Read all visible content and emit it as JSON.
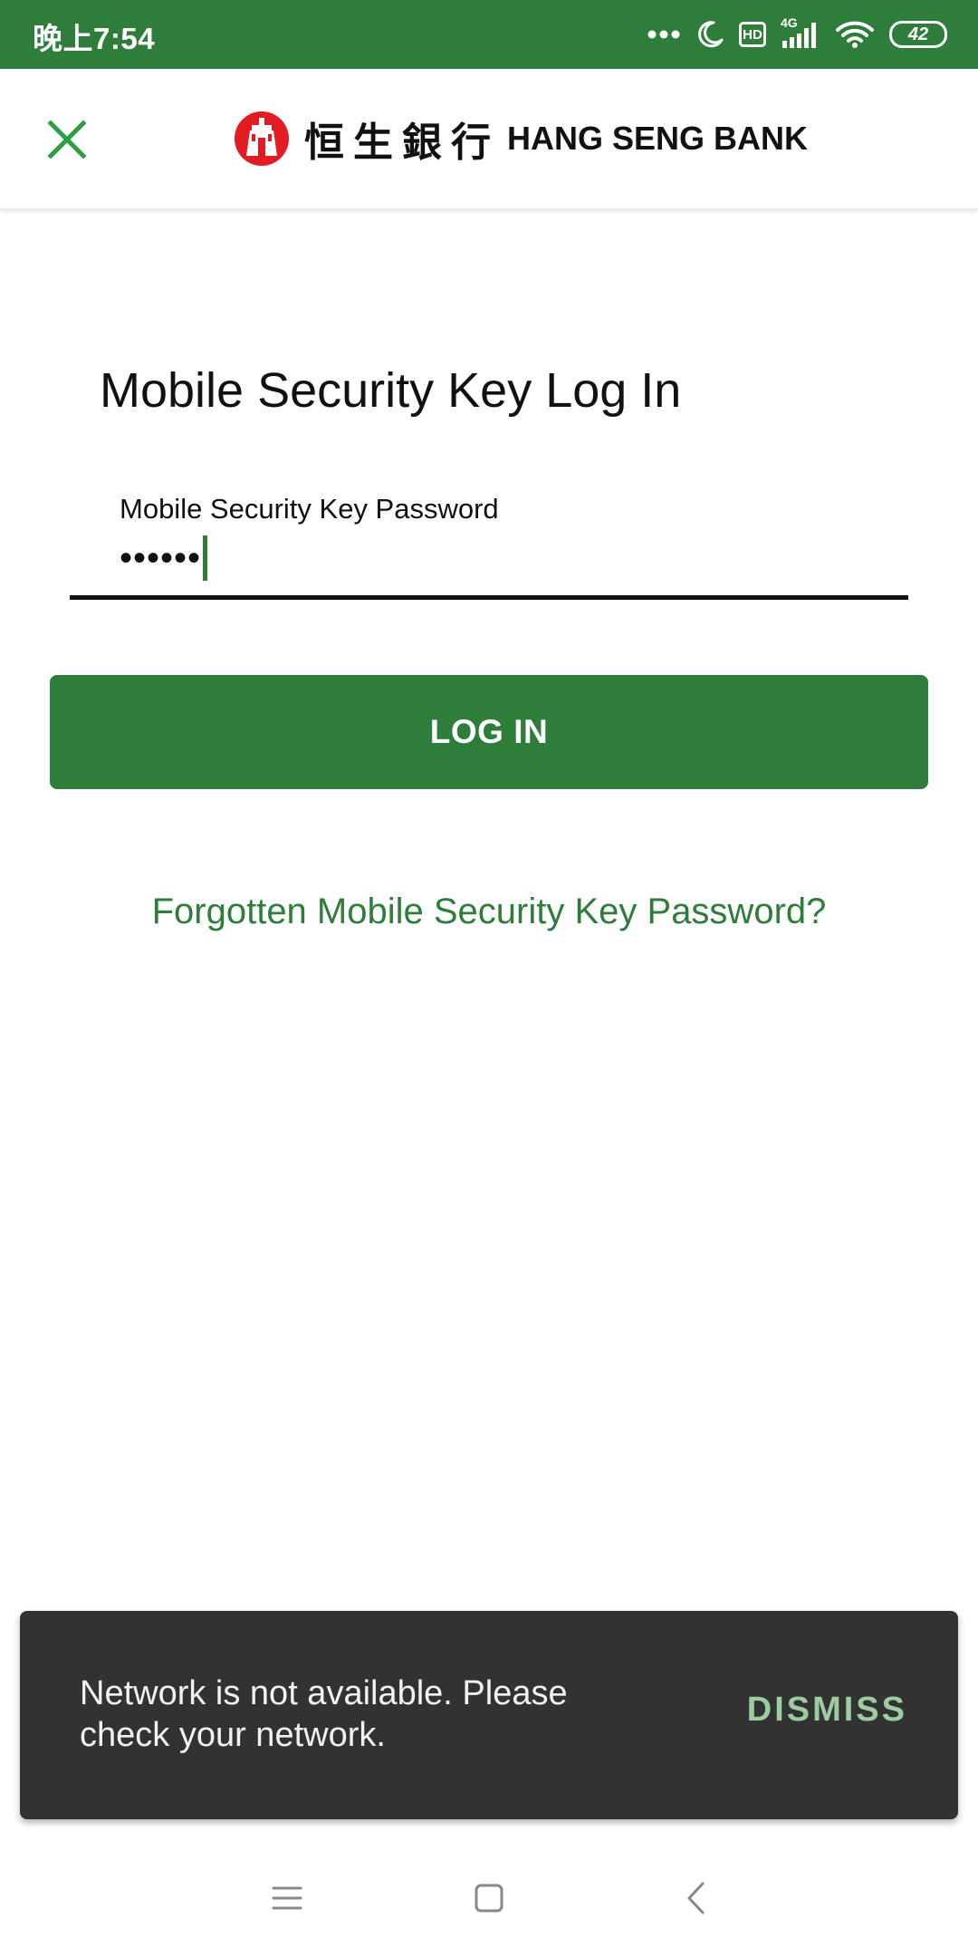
{
  "status_bar": {
    "time": "晚上7:54",
    "network_label": "4G",
    "hd_label": "HD",
    "battery": "42"
  },
  "header": {
    "logo_chinese": "恒生銀行",
    "logo_english": "HANG SENG BANK"
  },
  "main": {
    "title": "Mobile Security Key Log In",
    "password_label": "Mobile Security Key Password",
    "password_value": "••••••",
    "login_button": "LOG IN",
    "forgot_link": "Forgotten Mobile Security Key Password?"
  },
  "snackbar": {
    "message": "Network is not available. Please check your network.",
    "action": "DISMISS"
  },
  "colors": {
    "brand_green": "#2e7d3a",
    "snackbar_bg": "#323232",
    "snackbar_action": "#9ccc9f",
    "logo_red": "#e31b23"
  },
  "icons": {
    "close": "close-icon",
    "logo": "hang-seng-logo-icon",
    "nav_menu": "menu-icon",
    "nav_home": "home-icon",
    "nav_back": "back-icon"
  }
}
